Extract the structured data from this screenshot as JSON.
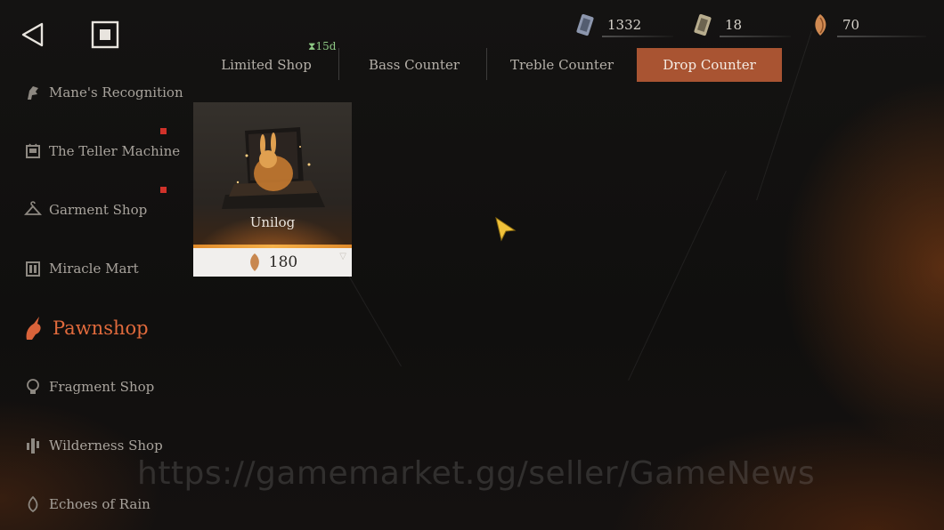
{
  "nav": {
    "back_icon": "back-triangle-icon",
    "home_icon": "stop-square-icon"
  },
  "currencies": [
    {
      "icon": "ticket-pass-icon",
      "amount": "1332"
    },
    {
      "icon": "gold-ticket-icon",
      "amount": "18"
    },
    {
      "icon": "drop-shell-icon",
      "amount": "70"
    }
  ],
  "tabs": [
    {
      "label": "Limited Shop",
      "timer": "15d"
    },
    {
      "label": "Bass Counter"
    },
    {
      "label": "Treble Counter"
    },
    {
      "label": "Drop Counter",
      "active": true
    }
  ],
  "sidebar": [
    {
      "label": "Mane's Recognition",
      "icon": "horse-head-icon"
    },
    {
      "label": "The Teller Machine",
      "icon": "teller-machine-icon",
      "badge": true
    },
    {
      "label": "Garment Shop",
      "icon": "hanger-icon",
      "badge": true
    },
    {
      "label": "Miracle Mart",
      "icon": "mart-icon"
    },
    {
      "label": "Pawnshop",
      "icon": "pawnshop-icon",
      "active": true
    },
    {
      "label": "Fragment Shop",
      "icon": "lightbulb-icon"
    },
    {
      "label": "Wilderness Shop",
      "icon": "cactus-icon"
    },
    {
      "label": "Echoes of Rain",
      "icon": "rain-drop-icon"
    }
  ],
  "items": [
    {
      "name": "Unilog",
      "price": "180",
      "price_icon": "drop-shell-icon"
    }
  ],
  "watermark": "https://gamemarket.gg/seller/GameNews",
  "colors": {
    "accent": "#a95432",
    "active_text": "#e06a3c",
    "badge": "#d0322a",
    "timer": "#8ec985"
  }
}
